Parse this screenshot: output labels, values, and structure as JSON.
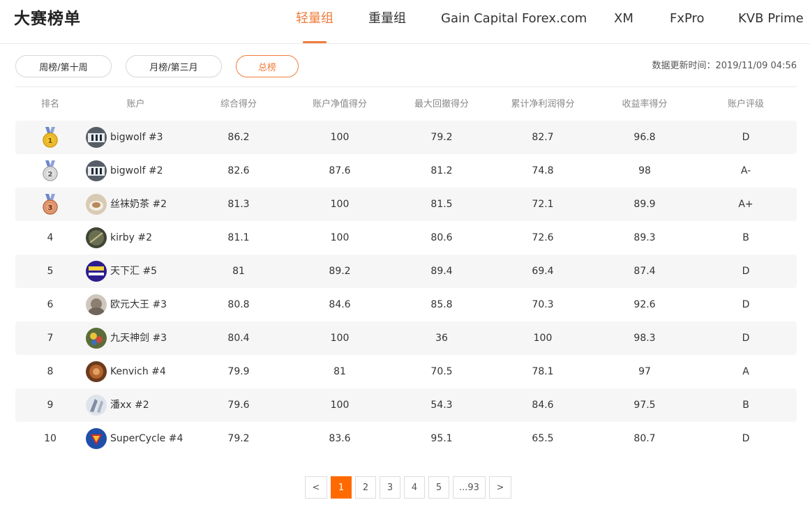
{
  "header": {
    "title": "大赛榜单",
    "tabs": [
      "轻量组",
      "重量组",
      "Gain Capital Forex.com",
      "XM",
      "FxPro",
      "KVB Prime"
    ],
    "active_tab": "轻量组"
  },
  "filters": {
    "weekly": "周榜/第十周",
    "monthly": "月榜/第三月",
    "overall": "总榜",
    "active": "总榜"
  },
  "updated": "数据更新时间：2019/11/09 04:56",
  "table": {
    "columns": [
      "排名",
      "账户",
      "综合得分",
      "账户净值得分",
      "最大回撤得分",
      "累计净利润得分",
      "收益率得分",
      "账户评级"
    ],
    "rows": [
      {
        "rank": "1",
        "account": "bigwolf #3",
        "score": "86.2",
        "equity": "100",
        "drawdown": "79.2",
        "profit": "82.7",
        "return": "96.8",
        "grade": "D",
        "medal": "gold"
      },
      {
        "rank": "2",
        "account": "bigwolf #2",
        "score": "82.6",
        "equity": "87.6",
        "drawdown": "81.2",
        "profit": "74.8",
        "return": "98",
        "grade": "A-",
        "medal": "silver"
      },
      {
        "rank": "3",
        "account": "丝袜奶茶 #2",
        "score": "81.3",
        "equity": "100",
        "drawdown": "81.5",
        "profit": "72.1",
        "return": "89.9",
        "grade": "A+",
        "medal": "bronze"
      },
      {
        "rank": "4",
        "account": "kirby #2",
        "score": "81.1",
        "equity": "100",
        "drawdown": "80.6",
        "profit": "72.6",
        "return": "89.3",
        "grade": "B"
      },
      {
        "rank": "5",
        "account": "天下汇 #5",
        "score": "81",
        "equity": "89.2",
        "drawdown": "89.4",
        "profit": "69.4",
        "return": "87.4",
        "grade": "D"
      },
      {
        "rank": "6",
        "account": "欧元大王 #3",
        "score": "80.8",
        "equity": "84.6",
        "drawdown": "85.8",
        "profit": "70.3",
        "return": "92.6",
        "grade": "D"
      },
      {
        "rank": "7",
        "account": "九天神剑 #3",
        "score": "80.4",
        "equity": "100",
        "drawdown": "36",
        "profit": "100",
        "return": "98.3",
        "grade": "D"
      },
      {
        "rank": "8",
        "account": "Kenvich #4",
        "score": "79.9",
        "equity": "81",
        "drawdown": "70.5",
        "profit": "78.1",
        "return": "97",
        "grade": "A"
      },
      {
        "rank": "9",
        "account": "潘xx #2",
        "score": "79.6",
        "equity": "100",
        "drawdown": "54.3",
        "profit": "84.6",
        "return": "97.5",
        "grade": "B"
      },
      {
        "rank": "10",
        "account": "SuperCycle #4",
        "score": "79.2",
        "equity": "83.6",
        "drawdown": "95.1",
        "profit": "65.5",
        "return": "80.7",
        "grade": "D"
      }
    ]
  },
  "pagination": {
    "prev": "<",
    "pages": [
      "1",
      "2",
      "3",
      "4",
      "5",
      "...93"
    ],
    "next": ">",
    "current": "1"
  },
  "colors": {
    "accent": "#f07c3a",
    "pager_active": "#ff6a00",
    "row_stripe": "#f6f6f6"
  }
}
